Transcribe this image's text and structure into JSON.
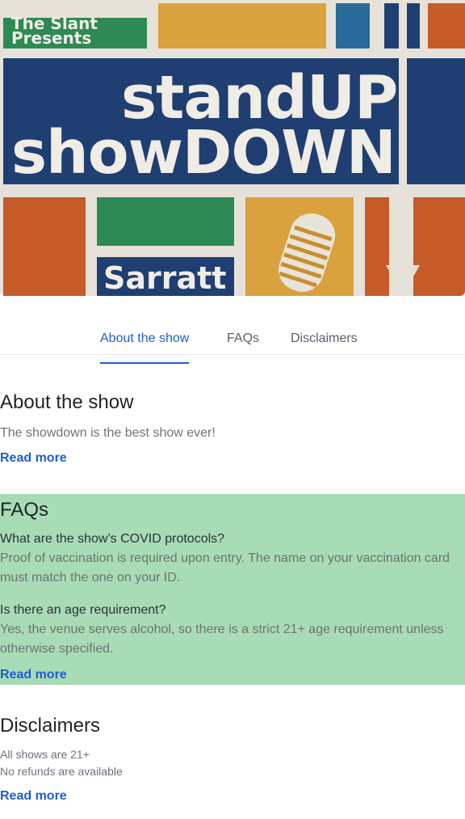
{
  "hero": {
    "presenter": "The Slant Presents",
    "title_line1": "standUP",
    "title_line2": "showDOWN",
    "venue": "Sarratt"
  },
  "tabs": [
    {
      "label": "About the show",
      "active": true
    },
    {
      "label": "FAQs",
      "active": false
    },
    {
      "label": "Disclaimers",
      "active": false
    }
  ],
  "about": {
    "title": "About the show",
    "text": "The showdown is the best show ever!",
    "read_more": "Read more"
  },
  "faqs": {
    "title": "FAQs",
    "items": [
      {
        "question": "What are the show’s COVID protocols?",
        "answer": "Proof of vaccination is required upon entry. The name on your vaccination card must match the one on your ID."
      },
      {
        "question": "Is there an age requirement?",
        "answer": "Yes, the venue serves alcohol, so there is a strict 21+ age requirement unless otherwise specified."
      }
    ],
    "read_more": "Read more",
    "background": "#a8dcb6"
  },
  "disclaimers": {
    "title": "Disclaimers",
    "lines": [
      "All shows are 21+",
      "No refunds are available"
    ],
    "read_more": "Read more"
  },
  "colors": {
    "accent": "#1d5fd1"
  }
}
